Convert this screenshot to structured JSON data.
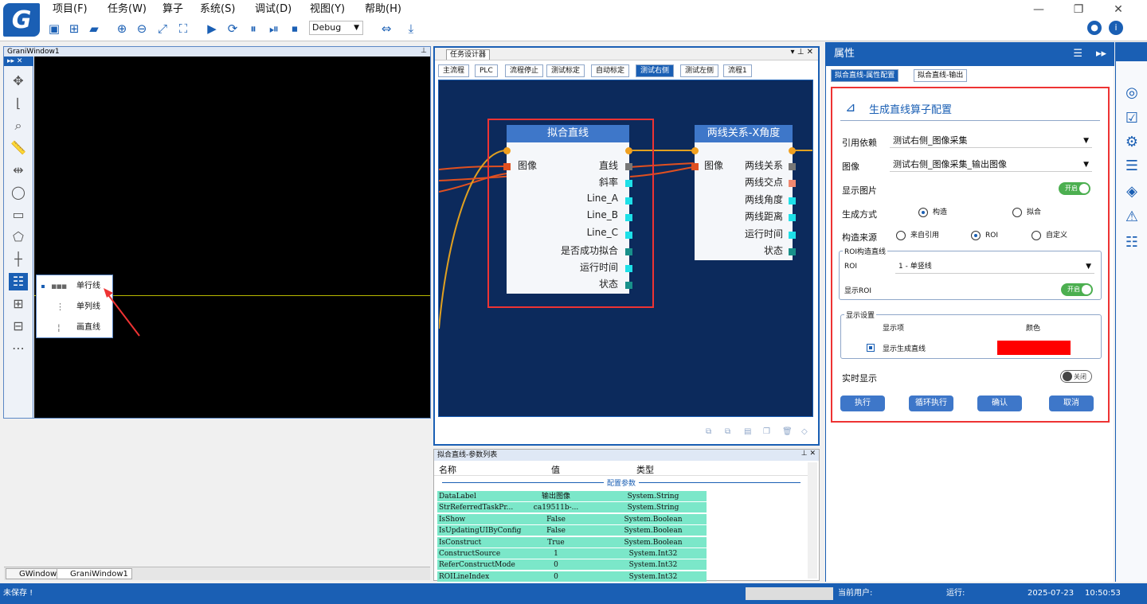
{
  "app": {
    "logo": "G",
    "menu": [
      "项目(F)",
      "任务(W)",
      "算子",
      "系统(S)",
      "调试(D)",
      "视图(Y)",
      "帮助(H)"
    ],
    "debug_mode": "Debug",
    "toolbar_icons": [
      "save-icon",
      "add-icon",
      "open-folder-icon",
      "zoom-in-icon",
      "zoom-out-icon",
      "fit-icon",
      "fullscreen-icon",
      "run-icon",
      "loop-icon",
      "pause-icon",
      "step-icon",
      "stop-icon",
      "split-icon",
      "download-icon"
    ]
  },
  "gwindow": {
    "title": "GraniWindow1",
    "popup": [
      "单行线",
      "单列线",
      "画直线"
    ],
    "tabs": [
      "GWindow",
      "GraniWindow1"
    ]
  },
  "task": {
    "title": "任务设计器",
    "tabs": [
      "主流程",
      "PLC",
      "流程停止",
      "测试标定",
      "自动标定",
      "测试右侧",
      "测试左侧",
      "流程1"
    ],
    "active_tab": "测试右侧",
    "node1": {
      "title": "拟合直线",
      "input": "图像",
      "outputs": [
        "直线",
        "斜率",
        "Line_A",
        "Line_B",
        "Line_C",
        "是否成功拟合",
        "运行时间",
        "状态"
      ]
    },
    "node2": {
      "title": "两线关系-X角度",
      "input": "图像",
      "outputs": [
        "两线关系",
        "两线交点",
        "两线角度",
        "两线距离",
        "运行时间",
        "状态"
      ]
    }
  },
  "params": {
    "title": "拟合直线-参数列表",
    "columns": [
      "名称",
      "值",
      "类型"
    ],
    "group": "配置参数",
    "rows": [
      [
        "DataLabel",
        "输出图像",
        "System.String"
      ],
      [
        "StrReferredTaskPr...",
        "ca19511b-...",
        "System.String"
      ],
      [
        "IsShow",
        "False",
        "System.Boolean"
      ],
      [
        "IsUpdatingUIByConfig",
        "False",
        "System.Boolean"
      ],
      [
        "IsConstruct",
        "True",
        "System.Boolean"
      ],
      [
        "ConstructSource",
        "1",
        "System.Int32"
      ],
      [
        "ReferConstructMode",
        "0",
        "System.Int32"
      ],
      [
        "ROILineIndex",
        "0",
        "System.Int32"
      ]
    ]
  },
  "props": {
    "title": "属性",
    "tabs": [
      "拟合直线-属性配置",
      "拟合直线-输出"
    ],
    "heading": "生成直线算子配置",
    "ref_label": "引用依赖",
    "ref_value": "测试右侧_图像采集",
    "image_label": "图像",
    "image_value": "测试右侧_图像采集_输出图像",
    "show_image_label": "显示图片",
    "toggle_on": "开启",
    "toggle_off": "关闭",
    "gen_mode_label": "生成方式",
    "gen_mode_options": [
      "构造",
      "拟合"
    ],
    "src_label": "构造来源",
    "src_options": [
      "来自引用",
      "ROI",
      "自定义"
    ],
    "roi_group": "ROI构造直线",
    "roi_label": "ROI",
    "roi_value": "1 - 单竖线",
    "show_roi_label": "显示ROI",
    "display_group": "显示设置",
    "display_item_col": "显示项",
    "display_color_col": "颜色",
    "display_item": "显示生成直线",
    "display_color": "#ff0000",
    "realtime_label": "实时显示",
    "buttons": [
      "执行",
      "循环执行",
      "确认",
      "取消"
    ]
  },
  "status": {
    "unsaved": "未保存 !",
    "user_label": "当前用户:",
    "run_label": "运行:",
    "date": "2025-07-23",
    "time": "10:50:53"
  },
  "colors": {
    "accent": "#1a5fb4",
    "flow_bg": "#0c2a5c",
    "highlight": "#e33333",
    "param_row": "#7be7c9"
  }
}
